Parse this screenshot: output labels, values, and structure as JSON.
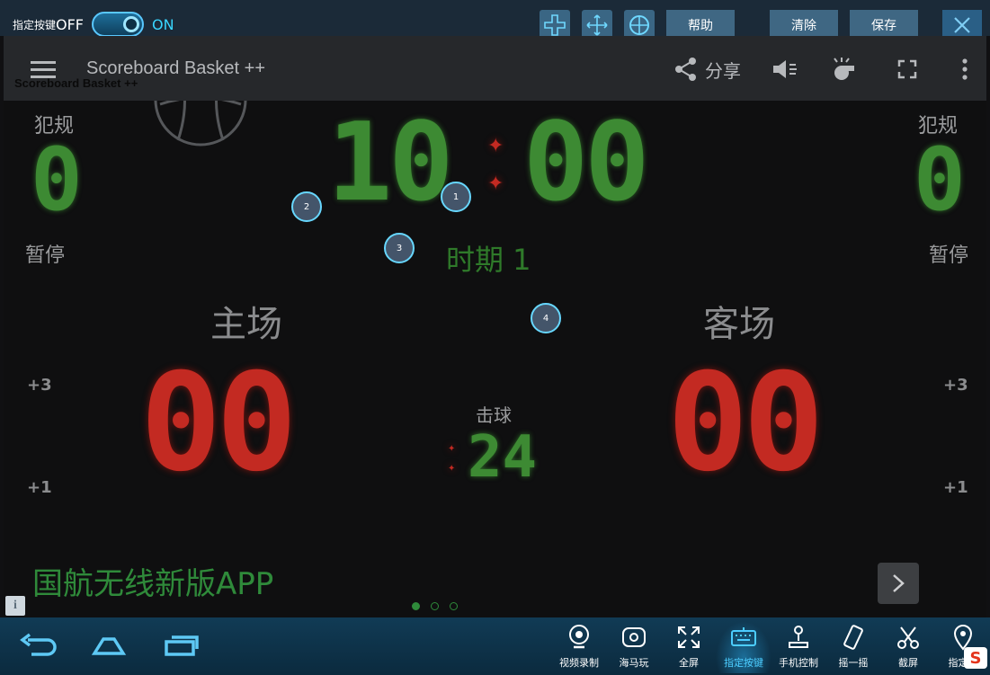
{
  "toolbar": {
    "key_label": "指定按键",
    "off_label": "OFF",
    "on_label": "ON",
    "help_label": "帮助",
    "clear_label": "清除",
    "save_label": "保存"
  },
  "appbar": {
    "title": "Scoreboard Basket ++",
    "subtitle": "Scoreboard Basket ++",
    "share_label": "分享"
  },
  "board": {
    "fouls_label_left": "犯规",
    "fouls_label_right": "犯规",
    "fouls_home": "0",
    "fouls_away": "0",
    "timeout_label_left": "暂停",
    "timeout_label_right": "暂停",
    "clock": {
      "minutes": "10",
      "seconds": "00"
    },
    "period_label": "时期 1",
    "home_label": "主场",
    "away_label": "客场",
    "home_score": "00",
    "away_score": "00",
    "shot_label": "击球",
    "shot_clock": "24",
    "plus3_left": "+3",
    "plus1_left": "+1",
    "plus3_right": "+3",
    "plus1_right": "+1"
  },
  "markers": [
    "1",
    "2",
    "3",
    "4"
  ],
  "ad": {
    "text": "国航无线新版APP"
  },
  "dock": {
    "items": [
      {
        "label": "视频录制",
        "icon": "webcam-icon"
      },
      {
        "label": "海马玩",
        "icon": "haima-icon"
      },
      {
        "label": "全屏",
        "icon": "fullscreen-icon"
      },
      {
        "label": "指定按键",
        "icon": "keyboard-icon"
      },
      {
        "label": "手机控制",
        "icon": "joystick-icon"
      },
      {
        "label": "摇一摇",
        "icon": "shake-icon"
      },
      {
        "label": "截屏",
        "icon": "scissors-icon"
      },
      {
        "label": "指定位",
        "icon": "location-icon"
      }
    ]
  },
  "colors": {
    "led_green": "#3d8a33",
    "led_red": "#c32a22",
    "accent": "#39d6ff"
  }
}
